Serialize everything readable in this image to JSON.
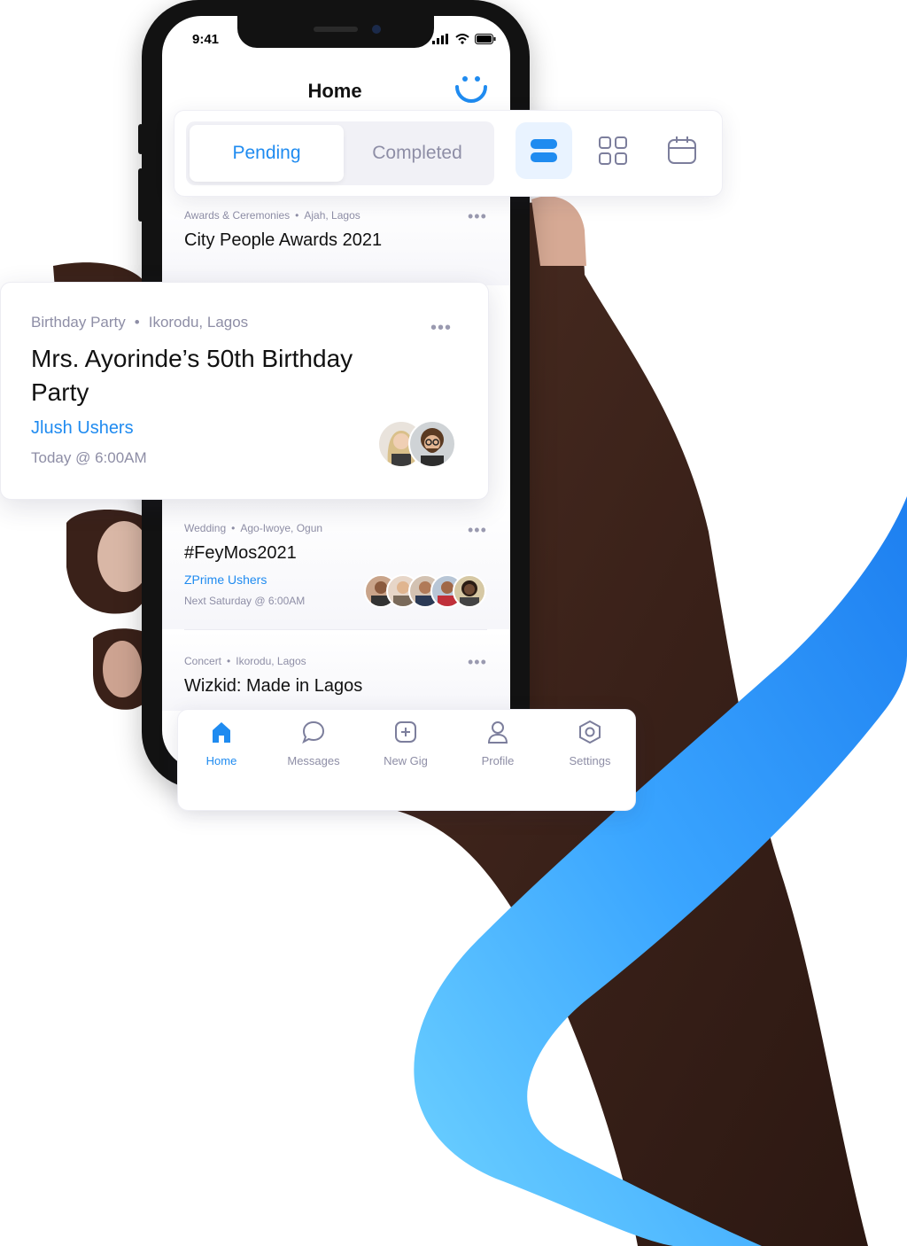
{
  "status_bar": {
    "time": "9:41"
  },
  "header": {
    "title": "Home"
  },
  "segment": {
    "pending": "Pending",
    "completed": "Completed",
    "active": "pending"
  },
  "view_toggle": {
    "icons": [
      "list-view-icon",
      "grid-view-icon",
      "calendar-view-icon"
    ],
    "active": "list-view-icon"
  },
  "events": [
    {
      "category": "Awards & Ceremonies",
      "location": "Ajah, Lagos",
      "title": "City People Awards 2021"
    },
    {
      "category": "Birthday Party",
      "location": "Ikorodu, Lagos",
      "title": "Mrs. Ayorinde’s 50th Birthday Party",
      "agency": "Jlush Ushers",
      "when": "Today @ 6:00AM"
    },
    {
      "category": "Wedding",
      "location": "Ago-Iwoye, Ogun",
      "title": "#FeyMos2021",
      "agency": "ZPrime Ushers",
      "when": "Next Saturday @ 6:00AM"
    },
    {
      "category": "Concert",
      "location": "Ikorodu, Lagos",
      "title": "Wizkid: Made in Lagos"
    }
  ],
  "nav": [
    {
      "label": "Home",
      "icon": "home-icon",
      "active": true
    },
    {
      "label": "Messages",
      "icon": "chat-bubble-icon",
      "active": false
    },
    {
      "label": "New Gig",
      "icon": "plus-square-icon",
      "active": false
    },
    {
      "label": "Profile",
      "icon": "user-icon",
      "active": false
    },
    {
      "label": "Settings",
      "icon": "hexagon-settings-icon",
      "active": false
    }
  ],
  "colors": {
    "accent": "#1f8bf0",
    "muted": "#8e8ea6",
    "ribbon": "#2e9bff"
  }
}
